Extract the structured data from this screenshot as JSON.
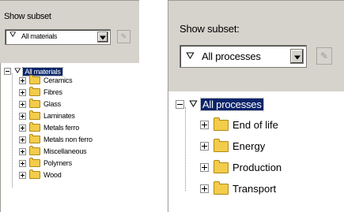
{
  "left_panel": {
    "label": "Show subset",
    "filter": {
      "value": "All materials"
    },
    "tree": {
      "root": "All materials",
      "items": [
        "Ceramics",
        "Fibres",
        "Glass",
        "Laminates",
        "Metals ferro",
        "Metals non ferro",
        "Miscellaneous",
        "Polymers",
        "Wood"
      ]
    }
  },
  "right_panel": {
    "label": "Show subset:",
    "filter": {
      "value": "All processes"
    },
    "tree": {
      "root": "All processes",
      "items": [
        "End of life",
        "Energy",
        "Production",
        "Transport"
      ]
    }
  },
  "icons": {
    "filter": "funnel-icon",
    "folder": "folder-icon",
    "expand": "plus-icon",
    "collapse": "minus-icon",
    "dropdown": "chevron-down-icon",
    "edit": "edit-icon"
  },
  "colors": {
    "selection": "#0a246a",
    "folder": "#f2cc4a",
    "panel": "#d6d3cc"
  }
}
